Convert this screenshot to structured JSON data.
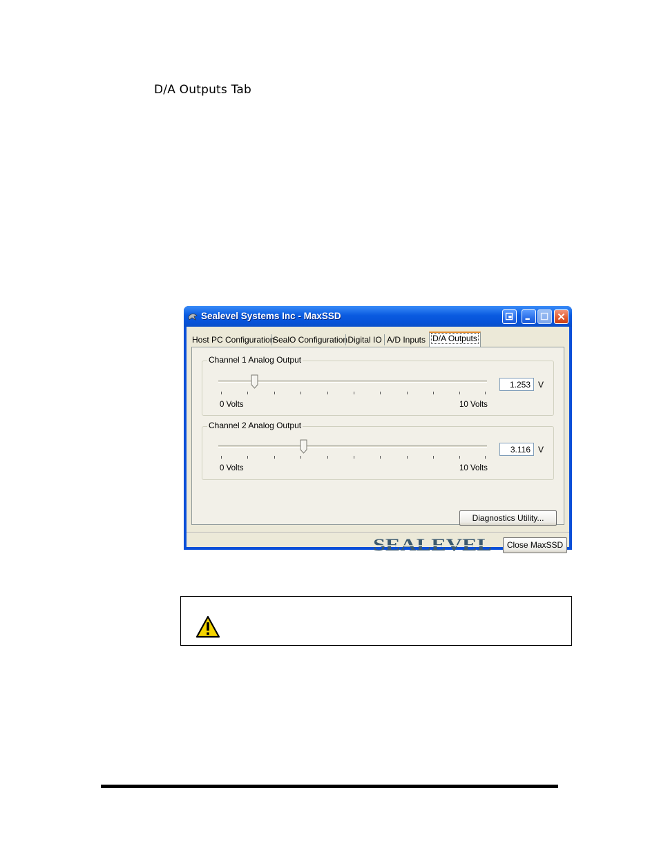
{
  "heading": "D/A Outputs Tab",
  "window": {
    "title": "Sealevel Systems Inc - MaxSSD",
    "tabs": [
      {
        "label": "Host PC Configuration"
      },
      {
        "label": "SealO Configuration"
      },
      {
        "label": "Digital IO"
      },
      {
        "label": "A/D Inputs"
      },
      {
        "label": "D/A Outputs",
        "active": true
      }
    ],
    "channels": [
      {
        "title": "Channel 1 Analog Output",
        "value": "1.253",
        "unit": "V",
        "min_label": "0 Volts",
        "max_label": "10 Volts",
        "level": 0.1253
      },
      {
        "title": "Channel 2 Analog Output",
        "value": "3.116",
        "unit": "V",
        "min_label": "0 Volts",
        "max_label": "10 Volts",
        "level": 0.3116
      }
    ],
    "diagnostics_label": "Diagnostics Utility...",
    "logo_text": "SEALEVEL",
    "close_label": "Close MaxSSD"
  },
  "colors": {
    "titlebar": "#0a5be0",
    "active_tab_accent": "#e68b2c",
    "dialog_face": "#ece9d8",
    "logo": "#3c5a70",
    "caution_fill": "#f4d400"
  },
  "icons": {
    "app": "app-icon",
    "caution": "warning-triangle-icon"
  }
}
